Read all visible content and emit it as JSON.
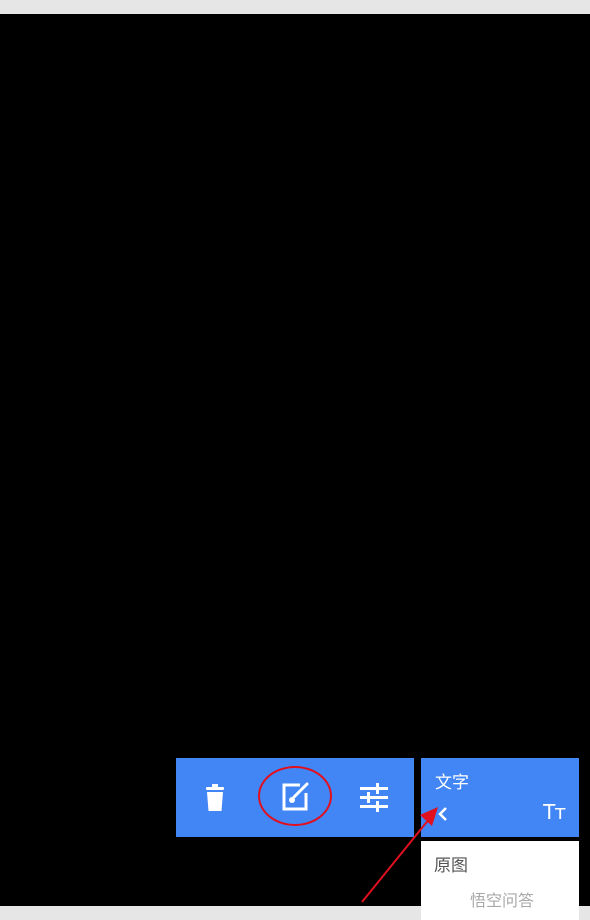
{
  "text_panel": {
    "title": "文字",
    "back_icon": "chevron-left-icon",
    "font_size_icon": "Tт"
  },
  "original_panel": {
    "label": "原图"
  },
  "toolbar": {
    "icons": [
      "trash-icon",
      "edit-image-icon",
      "sliders-icon"
    ]
  },
  "watermark": {
    "text": "悟空问答"
  },
  "colors": {
    "panel_blue": "#4285f4",
    "annotation_red": "#e0101e",
    "canvas": "#000000"
  }
}
